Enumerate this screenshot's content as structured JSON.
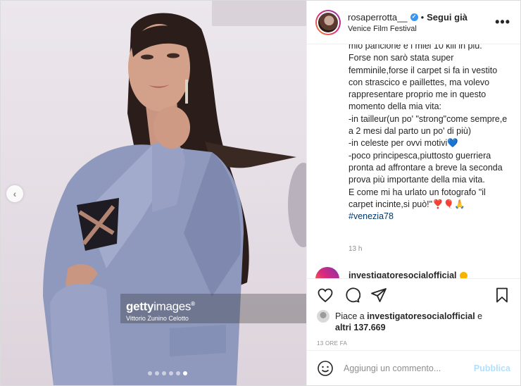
{
  "photo": {
    "watermark_brand_bold": "getty",
    "watermark_brand_thin": "images",
    "watermark_mark": "®",
    "watermark_credit": "Vittorio Zunino Celotto",
    "prev_arrow": "‹",
    "carousel_count": 6,
    "carousel_active_index": 5
  },
  "header": {
    "username": "rosaperrotta__",
    "verified_glyph": "✓",
    "separator": "•",
    "follow_label": "Segui già",
    "location": "Venice Film Festival",
    "more_label": "•••"
  },
  "caption": {
    "text": "mio pancione e i miei 10 kili in più.\nForse non sarò stata super femminile,forse il carpet si fa in vestito con strascico e paillettes, ma volevo rappresentare proprio me in questo momento della mia vita:\n-in tailleur(un po' \"strong\"come sempre,e a 2 mesi dal parto un po' di più)\n-in celeste per ovvi motivi💙\n-poco principesca,piuttosto guerriera pronta ad affrontare a breve la seconda prova più importante della mia vita.\nE come mi ha urlato un fotografo \"il carpet incinte,si può!\"❣️🎈🙏",
    "hashtag": "#venezia78",
    "time": "13 h"
  },
  "next_comment": {
    "username": "investigatoresocialofficial"
  },
  "likes": {
    "prefix": "Piace a ",
    "user": "investigatoresocialofficial",
    "and": " e",
    "others": "altri 137.669"
  },
  "post_time": "13 ORE FA",
  "comment_box": {
    "placeholder": "Aggiungi un commento...",
    "publish_label": "Pubblica"
  },
  "colors": {
    "accent_blue": "#3897f0",
    "publish_disabled": "#b2dffc",
    "hashtag": "#00376b",
    "suit": "#8f98bd"
  }
}
